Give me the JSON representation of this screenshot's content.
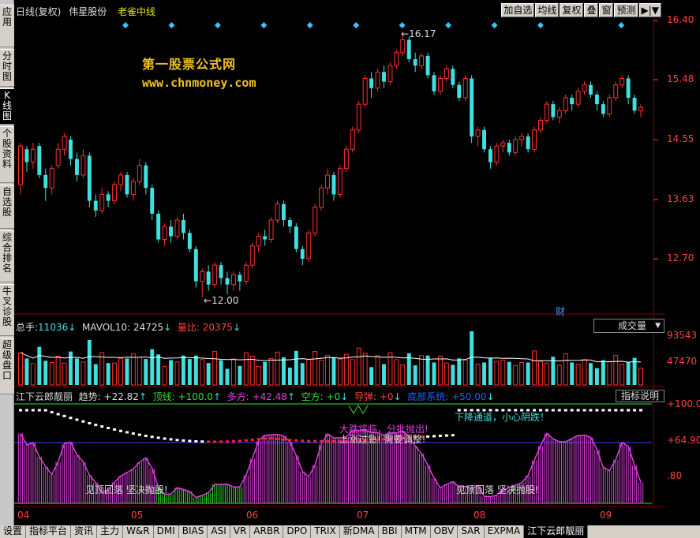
{
  "left_nav": [
    {
      "label": "应用",
      "active": false
    },
    {
      "label": "分时图",
      "active": false
    },
    {
      "label": "K线图",
      "active": true
    },
    {
      "label": "个股资料",
      "active": false
    },
    {
      "label": "自选股",
      "active": false
    },
    {
      "label": "综合排名",
      "active": false
    },
    {
      "label": "牛叉诊股",
      "active": false
    },
    {
      "label": "超级盘口",
      "active": false
    }
  ],
  "header": {
    "period": "日线(复权)",
    "stock_name": "伟星股份",
    "tag": "老雀中线",
    "buttons": [
      "加自选",
      "均线",
      "复权",
      "叠",
      "窗",
      "预测",
      "▶|▼"
    ]
  },
  "watermark": {
    "line1": "第一股票公式网",
    "line2": "www.chnmoney.com"
  },
  "price_axis": [
    "16.40",
    "15.48",
    "14.55",
    "13.63",
    "12.70"
  ],
  "price_high_label": "16.17",
  "price_low_label": "12.00",
  "cai_label": "财",
  "volume_header": {
    "total_label": "总手:",
    "total_value": "11036",
    "mavol_label": "MAVOL10:",
    "mavol_value": "24725",
    "ratio_label": "量比:",
    "ratio_value": "20375",
    "selector": "成交量"
  },
  "volume_axis": [
    "93543",
    "47470"
  ],
  "indicator_header": {
    "name": "江下云郎靓丽",
    "trend_label": "趋势:",
    "trend_value": "+22.82",
    "top_label": "顶线:",
    "top_value": "+100.0",
    "bull_label": "多方:",
    "bull_value": "+42.48",
    "bear_label": "空方:",
    "bear_value": "+0",
    "guide_label": "导弹:",
    "guide_value": "+0",
    "bottom_label": "底部系统:",
    "bottom_value": "+50.00",
    "explain_btn": "指标说明"
  },
  "indicator_axis": [
    "+100.0",
    "+64.90",
    ".80"
  ],
  "annotations": {
    "downtrend": "下降通道，小心阴跌！",
    "crash": "大跌将临，分批抛出!",
    "overbought": "上涨过急! 需要调整!",
    "peak_left": "见顶回落 坚决抛股!",
    "peak_right": "见顶回落 坚决抛股!"
  },
  "x_axis": [
    "04",
    "05",
    "06",
    "07",
    "08",
    "09"
  ],
  "bottom_tabs": [
    {
      "label": "设置",
      "active": false
    },
    {
      "label": "指标平台",
      "active": false
    },
    {
      "label": "资讯",
      "active": false
    },
    {
      "label": "主力",
      "active": false
    },
    {
      "label": "W&R",
      "active": false
    },
    {
      "label": "DMI",
      "active": false
    },
    {
      "label": "BIAS",
      "active": false
    },
    {
      "label": "ASI",
      "active": false
    },
    {
      "label": "VR",
      "active": false
    },
    {
      "label": "ARBR",
      "active": false
    },
    {
      "label": "DPO",
      "active": false
    },
    {
      "label": "TRIX",
      "active": false
    },
    {
      "label": "新DMA",
      "active": false
    },
    {
      "label": "BBI",
      "active": false
    },
    {
      "label": "MTM",
      "active": false
    },
    {
      "label": "OBV",
      "active": false
    },
    {
      "label": "SAR",
      "active": false
    },
    {
      "label": "EXPMA",
      "active": false
    },
    {
      "label": "江下云郎靓丽",
      "active": true
    }
  ],
  "colors": {
    "up": "#ff3030",
    "down": "#40e0e0",
    "axis": "#ff4040",
    "grid": "#800000",
    "indicator_magenta": "#e040e0",
    "indicator_green": "#30e030",
    "line_blue": "#4040ff",
    "text_yellow": "#e8e800"
  },
  "candles": [
    [
      13.85,
      14.45,
      13.7,
      14.5
    ],
    [
      14.4,
      14.2,
      14.05,
      14.45
    ],
    [
      14.2,
      14.4,
      14.1,
      14.5
    ],
    [
      14.45,
      14.0,
      13.95,
      14.5
    ],
    [
      14.0,
      13.8,
      13.6,
      14.1
    ],
    [
      13.8,
      14.1,
      13.7,
      14.15
    ],
    [
      14.15,
      14.4,
      14.1,
      14.5
    ],
    [
      14.4,
      14.6,
      14.3,
      14.65
    ],
    [
      14.55,
      14.25,
      14.15,
      14.6
    ],
    [
      14.25,
      14.0,
      13.9,
      14.35
    ],
    [
      14.0,
      14.3,
      13.95,
      14.4
    ],
    [
      14.3,
      13.6,
      13.5,
      14.35
    ],
    [
      13.6,
      13.45,
      13.35,
      13.7
    ],
    [
      13.45,
      13.7,
      13.4,
      13.8
    ],
    [
      13.7,
      13.6,
      13.5,
      13.75
    ],
    [
      13.6,
      13.85,
      13.55,
      13.9
    ],
    [
      13.85,
      14.0,
      13.75,
      14.05
    ],
    [
      14.0,
      13.7,
      13.65,
      14.05
    ],
    [
      13.7,
      13.9,
      13.6,
      13.95
    ],
    [
      13.9,
      14.15,
      13.85,
      14.25
    ],
    [
      14.15,
      13.8,
      13.7,
      14.2
    ],
    [
      13.8,
      13.4,
      13.3,
      13.85
    ],
    [
      13.4,
      13.0,
      12.95,
      13.45
    ],
    [
      13.0,
      13.2,
      12.9,
      13.25
    ],
    [
      13.2,
      13.05,
      12.95,
      13.3
    ],
    [
      13.05,
      13.3,
      13.0,
      13.35
    ],
    [
      13.3,
      13.1,
      13.0,
      13.4
    ],
    [
      13.1,
      12.85,
      12.8,
      13.15
    ],
    [
      12.85,
      12.35,
      12.25,
      12.9
    ],
    [
      12.35,
      12.5,
      12.1,
      12.55
    ],
    [
      12.5,
      12.3,
      12.2,
      12.6
    ],
    [
      12.3,
      12.6,
      12.25,
      12.65
    ],
    [
      12.6,
      12.4,
      12.3,
      12.65
    ],
    [
      12.4,
      12.3,
      12.15,
      12.5
    ],
    [
      12.3,
      12.45,
      12.2,
      12.5
    ],
    [
      12.45,
      12.35,
      12.2,
      12.5
    ],
    [
      12.35,
      12.6,
      12.3,
      12.65
    ],
    [
      12.6,
      12.9,
      12.55,
      12.95
    ],
    [
      12.9,
      13.05,
      12.8,
      13.1
    ],
    [
      13.05,
      13.0,
      12.9,
      13.15
    ],
    [
      13.0,
      13.3,
      12.95,
      13.35
    ],
    [
      13.3,
      13.55,
      13.25,
      13.6
    ],
    [
      13.55,
      13.3,
      13.2,
      13.6
    ],
    [
      13.3,
      13.2,
      13.1,
      13.35
    ],
    [
      13.2,
      12.85,
      12.8,
      13.25
    ],
    [
      12.85,
      12.7,
      12.6,
      12.9
    ],
    [
      12.7,
      13.1,
      12.65,
      13.15
    ],
    [
      13.1,
      13.5,
      13.05,
      13.55
    ],
    [
      13.5,
      13.8,
      13.45,
      13.85
    ],
    [
      13.8,
      14.0,
      13.7,
      14.1
    ],
    [
      14.0,
      13.7,
      13.6,
      14.05
    ],
    [
      13.7,
      14.1,
      13.65,
      14.15
    ],
    [
      14.1,
      14.4,
      14.05,
      14.45
    ],
    [
      14.4,
      14.7,
      14.35,
      14.75
    ],
    [
      14.7,
      15.1,
      14.65,
      15.15
    ],
    [
      15.1,
      15.5,
      15.05,
      15.55
    ],
    [
      15.5,
      15.35,
      15.2,
      15.6
    ],
    [
      15.35,
      15.6,
      15.3,
      15.65
    ],
    [
      15.6,
      15.45,
      15.35,
      15.7
    ],
    [
      15.45,
      15.7,
      15.4,
      15.75
    ],
    [
      15.7,
      15.9,
      15.65,
      15.95
    ],
    [
      15.9,
      16.1,
      15.85,
      16.17
    ],
    [
      16.1,
      15.8,
      15.75,
      16.15
    ],
    [
      15.8,
      15.7,
      15.6,
      15.9
    ],
    [
      15.7,
      15.85,
      15.65,
      15.9
    ],
    [
      15.85,
      15.55,
      15.5,
      15.9
    ],
    [
      15.55,
      15.3,
      15.25,
      15.6
    ],
    [
      15.3,
      15.5,
      15.25,
      15.55
    ],
    [
      15.5,
      15.65,
      15.45,
      15.7
    ],
    [
      15.65,
      15.4,
      15.35,
      15.7
    ],
    [
      15.4,
      15.2,
      15.15,
      15.45
    ],
    [
      15.2,
      15.5,
      15.15,
      15.55
    ],
    [
      15.5,
      14.6,
      14.5,
      15.55
    ],
    [
      14.6,
      14.7,
      14.45,
      14.75
    ],
    [
      14.7,
      14.4,
      14.35,
      14.75
    ],
    [
      14.4,
      14.2,
      14.1,
      14.45
    ],
    [
      14.2,
      14.45,
      14.15,
      14.5
    ],
    [
      14.45,
      14.5,
      14.35,
      14.55
    ],
    [
      14.5,
      14.35,
      14.3,
      14.55
    ],
    [
      14.35,
      14.55,
      14.3,
      14.6
    ],
    [
      14.55,
      14.6,
      14.45,
      14.65
    ],
    [
      14.6,
      14.4,
      14.35,
      14.65
    ],
    [
      14.4,
      14.7,
      14.35,
      14.75
    ],
    [
      14.7,
      14.85,
      14.65,
      14.9
    ],
    [
      14.85,
      15.1,
      14.8,
      15.15
    ],
    [
      15.1,
      14.9,
      14.85,
      15.15
    ],
    [
      14.9,
      15.0,
      14.8,
      15.05
    ],
    [
      15.0,
      15.2,
      14.95,
      15.25
    ],
    [
      15.2,
      15.1,
      15.0,
      15.25
    ],
    [
      15.1,
      15.3,
      15.05,
      15.35
    ],
    [
      15.3,
      15.4,
      15.25,
      15.45
    ],
    [
      15.4,
      15.25,
      15.2,
      15.45
    ],
    [
      15.25,
      15.1,
      15.0,
      15.3
    ],
    [
      15.1,
      14.95,
      14.9,
      15.15
    ],
    [
      14.95,
      15.2,
      14.9,
      15.25
    ],
    [
      15.2,
      15.4,
      15.15,
      15.45
    ],
    [
      15.4,
      15.5,
      15.35,
      15.55
    ],
    [
      15.5,
      15.2,
      15.1,
      15.55
    ],
    [
      15.2,
      15.0,
      14.95,
      15.25
    ],
    [
      15.0,
      15.05,
      14.9,
      15.1
    ]
  ]
}
